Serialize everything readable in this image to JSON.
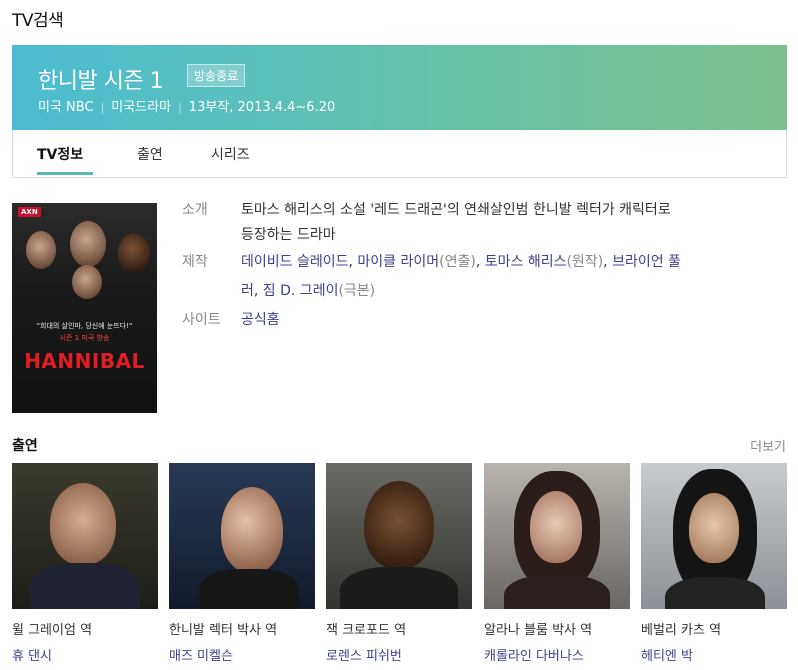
{
  "page": {
    "section_title": "TV검색"
  },
  "show": {
    "title": "한니발 시즌 1",
    "status": "방송종료",
    "country": "미국 NBC",
    "genre": "미국드라마",
    "episodes": "13부작, 2013.4.4~6.20",
    "hero_colors": [
      "#4cbcd3",
      "#7dc08f"
    ]
  },
  "tabs": [
    {
      "label": "TV정보",
      "active": true
    },
    {
      "label": "출연",
      "active": false
    },
    {
      "label": "시리즈",
      "active": false
    }
  ],
  "poster": {
    "channel": "AXN",
    "tagline": "\"희대의 살인마, 당신에 눈뜨다!\"",
    "tagline2": "시즌 1 미국 방송",
    "name": "HANNIBAL"
  },
  "info": {
    "intro_label": "소개",
    "intro_line1": "토마스 해리스의 소설 '레드 드래곤'의 연쇄살인범 한니발 렉터가 캐릭터로",
    "intro_line2": "등장하는 드라마",
    "production_label": "제작",
    "production": [
      {
        "name": "데이비드 슬레이드",
        "role": "(연출)"
      },
      {
        "name": "마이클 라이머",
        "role": "(연출)"
      },
      {
        "name": "토마스 해리스",
        "role": "(원작)"
      },
      {
        "name": "브라이언 풀러",
        "role": ""
      },
      {
        "name": "짐 D. 그레이",
        "role": "(극본)"
      }
    ],
    "production_name_4a": "브라이언 풀",
    "production_name_4b": "러",
    "site_label": "사이트",
    "site_link": "공식홈"
  },
  "cast": {
    "title": "출연",
    "more_label": "더보기",
    "members": [
      {
        "role": "윌 그레이엄 역",
        "name": "휴 댄시"
      },
      {
        "role": "한니발 렉터 박사 역",
        "name": "매즈 미켈슨"
      },
      {
        "role": "잭 크로포드 역",
        "name": "로렌스 피쉬번"
      },
      {
        "role": "알라나 블룸 박사 역",
        "name": "캐롤라인 다버나스"
      },
      {
        "role": "베벌리 카츠 역",
        "name": "헤티엔 박"
      }
    ]
  }
}
